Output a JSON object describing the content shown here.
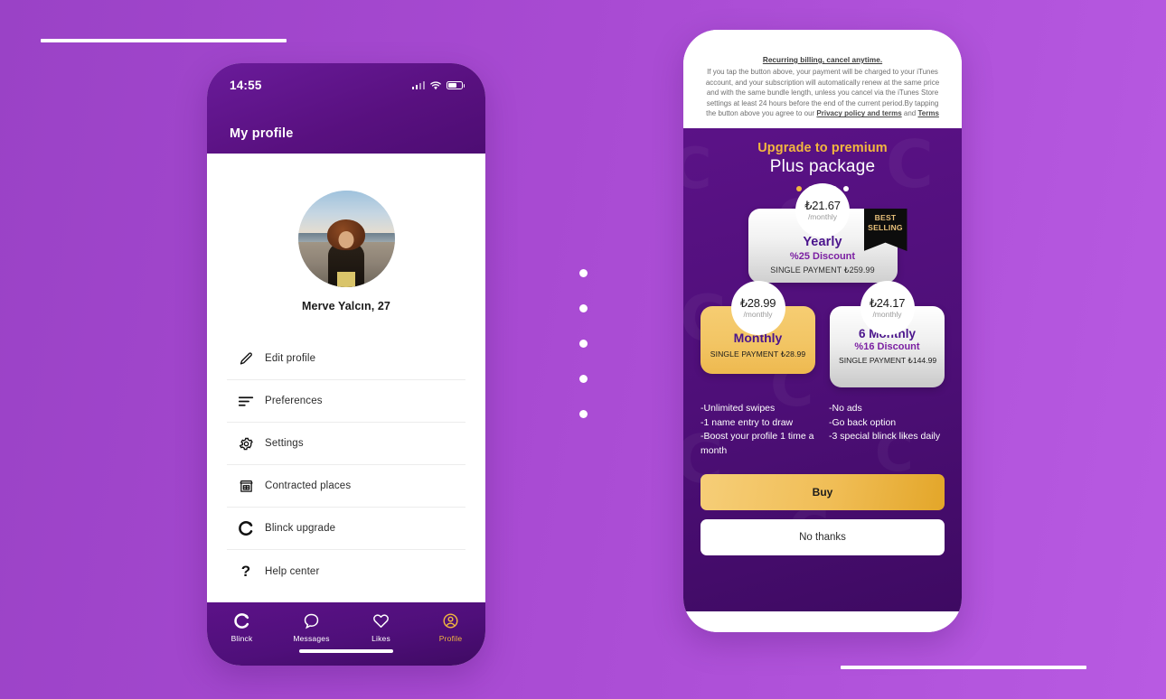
{
  "background": {
    "accent_purple": "#9a42c6",
    "accent_purple_right": "#b85ae2"
  },
  "left_phone": {
    "status_bar": {
      "time": "14:55",
      "signal_icon": "cellular-signal-icon",
      "wifi_icon": "wifi-icon",
      "battery_icon": "battery-icon"
    },
    "header_title": "My profile",
    "profile": {
      "name_age": "Merve Yalcın, 27",
      "avatar_alt": "profile-photo"
    },
    "menu_items": [
      {
        "icon": "pencil-icon",
        "label": "Edit profile"
      },
      {
        "icon": "sliders-icon",
        "label": "Preferences"
      },
      {
        "icon": "gear-icon",
        "label": "Settings"
      },
      {
        "icon": "storefront-icon",
        "label": "Contracted places"
      },
      {
        "icon": "blinck-logo-icon",
        "label": "Blinck upgrade"
      },
      {
        "icon": "question-mark-icon",
        "label": "Help center"
      }
    ],
    "nav_items": [
      {
        "icon": "blinck-logo-icon",
        "label": "Blinck",
        "active": false
      },
      {
        "icon": "chat-bubble-icon",
        "label": "Messages",
        "active": false
      },
      {
        "icon": "heart-icon",
        "label": "Likes",
        "active": false
      },
      {
        "icon": "user-circle-icon",
        "label": "Profile",
        "active": true
      }
    ]
  },
  "right_phone": {
    "terms": {
      "title": "Recurring billing, cancel anytime.",
      "body_part1": "If you tap the button above, your payment will be charged to your iTunes account, and your subscription will automatically renew at the same price and with the same bundle length, unless you cancel via the iTunes Store settings at least 24 hours before the end of the current period.By tapping the button above you agree to our ",
      "link1": "Privacy policy and terms",
      "body_part2": " and ",
      "link2": "Terms"
    },
    "promo": {
      "headline": "Upgrade to premium",
      "subhead": "Plus package",
      "dots_total": 5,
      "dots_active_index": 0
    },
    "plans": {
      "yearly": {
        "bubble_price": "₺21.67",
        "bubble_period": "/monthly",
        "ribbon_line1": "BEST",
        "ribbon_line2": "SELLING",
        "title": "Yearly",
        "discount": "%25 Discount",
        "single_payment": "SINGLE PAYMENT ₺259.99"
      },
      "monthly": {
        "bubble_price": "₺28.99",
        "bubble_period": "/monthly",
        "title": "Monthly",
        "single_payment": "SINGLE PAYMENT ₺28.99"
      },
      "six_monthly": {
        "bubble_price": "₺24.17",
        "bubble_period": "/monthly",
        "title": "6 Monthly",
        "discount": "%16 Discount",
        "single_payment": "SINGLE PAYMENT\n₺144.99"
      }
    },
    "features": {
      "column_left": "-Unlimited swipes\n-1 name entry to draw\n-Boost your profile 1 time a month",
      "column_right": "-No ads\n-Go back option\n-3 special blinck likes daily"
    },
    "buttons": {
      "buy": "Buy",
      "no_thanks": "No thanks"
    }
  }
}
